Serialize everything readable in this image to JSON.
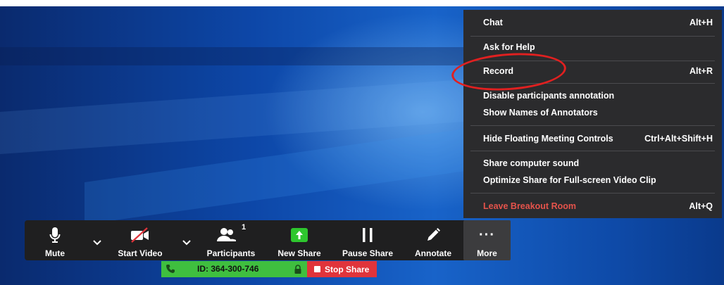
{
  "menu": {
    "items": [
      {
        "label": "Chat",
        "shortcut": "Alt+H"
      },
      {
        "label": "Ask for Help",
        "shortcut": ""
      },
      {
        "label": "Record",
        "shortcut": "Alt+R"
      },
      {
        "label": "Disable participants annotation",
        "shortcut": ""
      },
      {
        "label": "Show Names of Annotators",
        "shortcut": ""
      },
      {
        "label": "Hide Floating Meeting Controls",
        "shortcut": "Ctrl+Alt+Shift+H"
      },
      {
        "label": "Share computer sound",
        "shortcut": ""
      },
      {
        "label": "Optimize Share for Full-screen Video Clip",
        "shortcut": ""
      },
      {
        "label": "Leave Breakout Room",
        "shortcut": "Alt+Q"
      }
    ]
  },
  "toolbar": {
    "mute_label": "Mute",
    "video_label": "Start Video",
    "participants_label": "Participants",
    "participants_count": "1",
    "new_share_label": "New Share",
    "pause_share_label": "Pause Share",
    "annotate_label": "Annotate",
    "more_label": "More",
    "more_icon_text": "···"
  },
  "status": {
    "meeting_id": "ID: 364-300-746",
    "stop_share_label": "Stop Share"
  },
  "colors": {
    "menu_bg": "#2b2b2d",
    "share_green": "#3fbf3f",
    "stop_red": "#e0343b",
    "ring_red": "#e02020",
    "leave_text": "#e5534b"
  }
}
